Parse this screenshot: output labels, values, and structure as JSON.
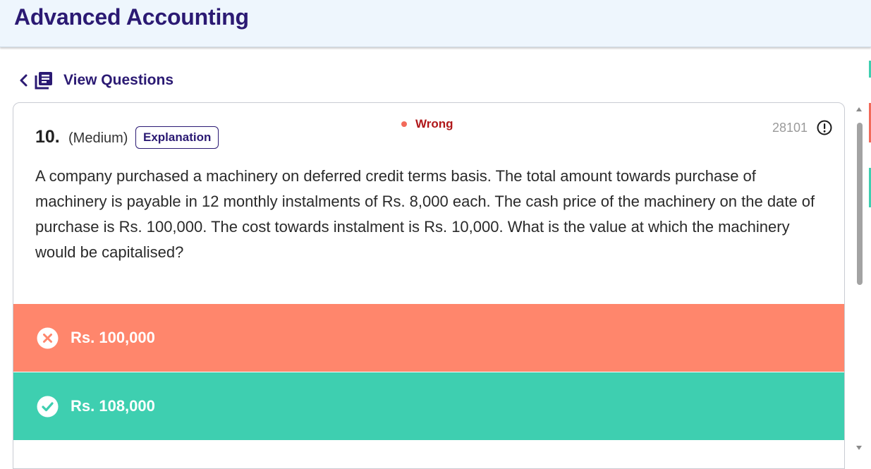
{
  "header": {
    "title": "Advanced Accounting"
  },
  "nav": {
    "back_icon": "chevron-left-icon",
    "book_icon": "question-list-icon",
    "view_questions_label": "View Questions"
  },
  "question": {
    "number": "10.",
    "difficulty": "(Medium)",
    "explanation_label": "Explanation",
    "status": "Wrong",
    "status_color": "#b0181a",
    "id": "28101",
    "text": "A company purchased a machinery on deferred credit terms basis. The total amount towards purchase of machinery is payable in 12 monthly instalments of Rs. 8,000 each. The cash price of the machinery on the date of purchase is Rs. 100,000. The cost towards instalment is Rs. 10,000. What is the value at which the machinery would be capitalised?"
  },
  "options": [
    {
      "label": "Rs. 100,000",
      "state": "wrong",
      "icon": "x-circle-icon",
      "color": "#ff866c"
    },
    {
      "label": "Rs. 108,000",
      "state": "correct",
      "icon": "check-circle-icon",
      "color": "#3ecfb0"
    }
  ],
  "colors": {
    "brand": "#2b1a73",
    "header_bg": "#eef6fd"
  }
}
